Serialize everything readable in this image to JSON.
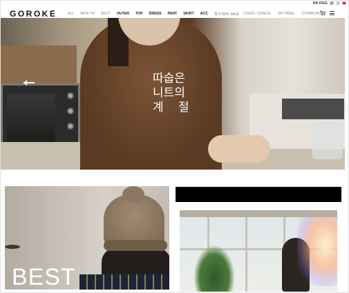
{
  "util": {
    "brand_badge": "OK.DGG",
    "flags": [
      "us-flag-icon",
      "jp-flag-icon",
      "cn-flag-icon"
    ]
  },
  "header": {
    "logo": "GOROKE",
    "nav": [
      {
        "label": "ALL",
        "style": "light"
      },
      {
        "label": "NEW 7%",
        "style": "light"
      },
      {
        "label": "BEST",
        "style": "light"
      },
      {
        "label": "OUTER",
        "style": "bold"
      },
      {
        "label": "TOP",
        "style": "bold"
      },
      {
        "label": "DRESS",
        "style": "bold"
      },
      {
        "label": "PANT",
        "style": "bold"
      },
      {
        "label": "SKIRT",
        "style": "bold"
      },
      {
        "label": "ACC",
        "style": "bold"
      },
      {
        "label": "특가 80% SALE",
        "style": "sale"
      }
    ],
    "links": [
      "LOGIN / JOINUS",
      "MY PAGE",
      "COMMUNITY"
    ],
    "cart_icon": "cart-icon",
    "menu_icon": "hamburger-menu-icon"
  },
  "hero": {
    "title_lines": [
      "따숩은",
      "니트의",
      "계 절"
    ],
    "prev_icon": "arrow-left-icon"
  },
  "cards": {
    "best_label": "BEST"
  },
  "colors": {
    "text": "#111111",
    "muted": "#888888",
    "black_bar": "#000000"
  }
}
